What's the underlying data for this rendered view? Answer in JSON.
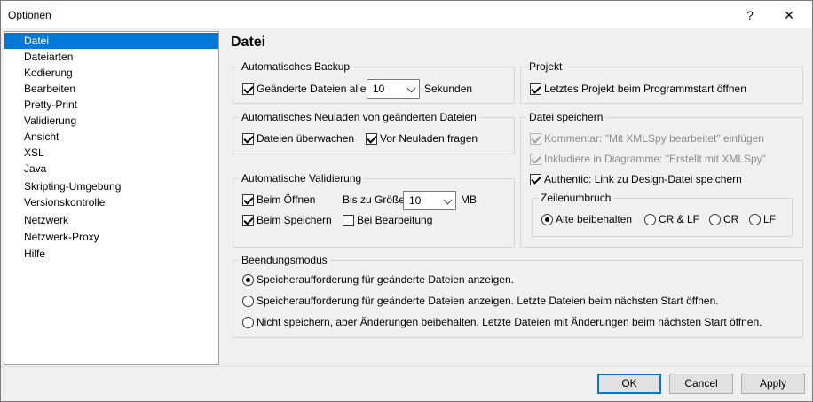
{
  "window": {
    "title": "Optionen",
    "help_label": "?",
    "close_label": "✕"
  },
  "sidebar": {
    "items": [
      {
        "label": "Datei"
      },
      {
        "label": "Dateiarten"
      },
      {
        "label": "Kodierung"
      },
      {
        "label": "Bearbeiten"
      },
      {
        "label": "Pretty-Print"
      },
      {
        "label": "Validierung"
      },
      {
        "label": "Ansicht"
      },
      {
        "label": "XSL"
      },
      {
        "label": "Java"
      },
      {
        "label": "Skripting-Umgebung"
      },
      {
        "label": "Versionskontrolle"
      },
      {
        "label": "Netzwerk"
      },
      {
        "label": "Netzwerk-Proxy"
      },
      {
        "label": "Hilfe"
      }
    ]
  },
  "panel": {
    "title": "Datei"
  },
  "backup": {
    "label": "Automatisches Backup",
    "changed_files": "Geänderte Dateien alle",
    "interval_value": "10",
    "seconds": "Sekunden"
  },
  "reload": {
    "label": "Automatisches Neuladen von geänderten Dateien",
    "watch": "Dateien überwachen",
    "ask": "Vor Neuladen fragen"
  },
  "validation": {
    "label": "Automatische Validierung",
    "on_open": "Beim Öffnen",
    "max_size_label": "Bis zu Größe",
    "max_size_value": "10",
    "unit": "MB",
    "on_save": "Beim Speichern",
    "on_edit": "Bei Bearbeitung"
  },
  "project": {
    "label": "Projekt",
    "open_last": "Letztes Projekt beim Programmstart öffnen"
  },
  "save": {
    "label": "Datei speichern",
    "comment": "Kommentar: \"Mit XMLSpy bearbeitet\" einfügen",
    "include_diagram": "Inkludiere in Diagramme: \"Erstellt mit XMLSpy\"",
    "authentic_link": "Authentic: Link zu Design-Datei speichern",
    "line_break": {
      "label": "Zeilenumbruch",
      "keep": "Alte beibehalten",
      "crlf": "CR & LF",
      "cr": "CR",
      "lf": "LF"
    }
  },
  "exit": {
    "label": "Beendungsmodus",
    "opt1": "Speicheraufforderung für geänderte Dateien anzeigen.",
    "opt2": "Speicheraufforderung für geänderte Dateien anzeigen. Letzte Dateien beim nächsten Start öffnen.",
    "opt3": "Nicht speichern, aber Änderungen beibehalten. Letzte Dateien mit Änderungen beim nächsten Start öffnen."
  },
  "buttons": {
    "ok": "OK",
    "cancel": "Cancel",
    "apply": "Apply"
  },
  "colors": {
    "selection": "#0078d7",
    "dialog_bg": "#f0f0f0"
  }
}
